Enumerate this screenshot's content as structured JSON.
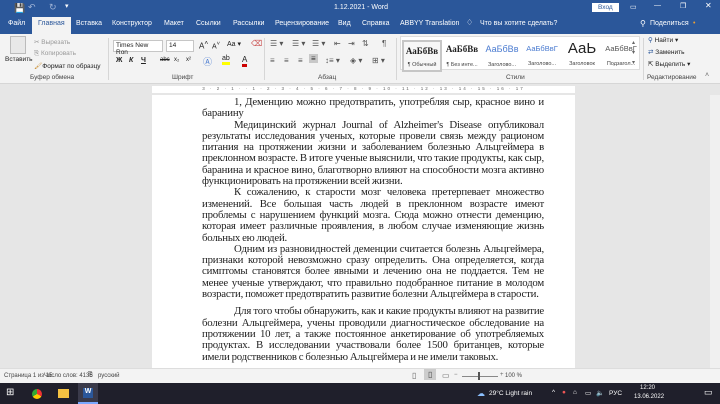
{
  "titlebar": {
    "title": "1.12.2021 - Word",
    "signin": "Вход"
  },
  "tabs": [
    "Файл",
    "Главная",
    "Вставка",
    "Конструктор",
    "Макет",
    "Ссылки",
    "Рассылки",
    "Рецензирование",
    "Вид",
    "Справка",
    "ABBYY Translation"
  ],
  "tellme": "Что вы хотите сделать?",
  "share": "Поделиться",
  "clipboard": {
    "paste": "Вставить",
    "cut": "Вырезать",
    "copy": "Копировать",
    "format": "Формат по образцу",
    "label": "Буфер обмена"
  },
  "font": {
    "name": "Times New Ron",
    "size": "14",
    "label": "Шрифт",
    "bold": "Ж",
    "italic": "К",
    "underline": "Ч",
    "strike": "abc",
    "sub": "x₂",
    "sup": "x²"
  },
  "paragraph": {
    "label": "Абзац"
  },
  "styles": {
    "label": "Стили",
    "items": [
      {
        "sample": "АаБбВв",
        "name": "¶ Обычный"
      },
      {
        "sample": "АаБбВв",
        "name": "¶ Без инте..."
      },
      {
        "sample": "АаБбВв",
        "name": "Заголово..."
      },
      {
        "sample": "АаБбВвГ",
        "name": "Заголово..."
      },
      {
        "sample": "АаЬ",
        "name": "Заголовок"
      },
      {
        "sample": "АаБбВвГ",
        "name": "Подзагол..."
      }
    ]
  },
  "editing": {
    "find": "Найти",
    "replace": "Заменить",
    "select": "Выделить",
    "label": "Редактирование"
  },
  "ruler": "3 · 2 · 1 · · 1 · 2 · 3 · 4 · 5 · 6 · 7 · 8 · 9 · 10 · 11 · 12 · 13 · 14 · 15 · 16 · 17",
  "document": {
    "paragraphs": [
      "1, Деменцию можно предотвратить, употребляя сыр, красное вино и баранину",
      "Медицинский журнал Journal of Alzheimer's Disease опубликовал результаты исследования ученых, которые провели связь между рационом питания на протяжении жизни и заболеванием болезнью Альцгеймера в преклонном возрасте. В итоге ученые выяснили, что такие продукты, как сыр, баранина и красное вино, благотворно влияют на способности мозга активно функционировать на протяжении всей жизни.",
      "К сожалению, к старости мозг человека претерпевает множество изменений. Все большая часть людей в преклонном возрасте имеют проблемы с нарушением функций мозга. Сюда можно отнести деменцию, которая имеет различные проявления, в любом случае изменяющие жизнь больных ею людей.",
      "Одним из разновидностей деменции считается болезнь Альцгеймера, признаки которой невозможно сразу определить. Она определяется, когда симптомы становятся более явными и лечению она не поддается. Тем не менее ученые утверждают, что правильно подобранное питание в молодом возрасти, поможет предотвратить развитие болезни Альцгеймера в старости.",
      "Для того чтобы обнаружить, как и какие продукты влияют на развитие болезни Альцгеймера, учены проводили диагностическое обследование на протяжении 10 лет, а также постоянное анкетирование об употребляемых продуктах. В исследовании участвовали более 1500 британцев, которые имели родственников с болезнью Альцгеймера и не имели таковых."
    ]
  },
  "status": {
    "page": "Страница 1 из 15",
    "words": "Число слов: 4136",
    "lang": "русский",
    "zoom": "100 %"
  },
  "taskbar": {
    "weather": "29°C  Light rain",
    "lang": "РУС",
    "time": "12:20",
    "date": "13.06.2022"
  }
}
